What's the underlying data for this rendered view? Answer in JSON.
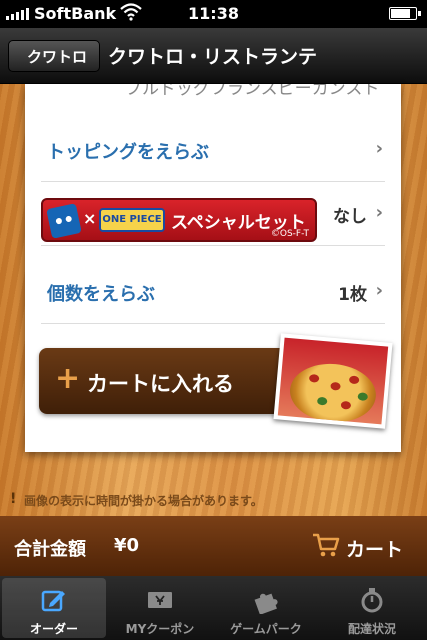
{
  "status_bar": {
    "carrier": "SoftBank",
    "time": "11:38",
    "battery_level": 0.85
  },
  "nav": {
    "back_label": "クワトロ",
    "title": "クワトロ・リストランテ"
  },
  "card": {
    "clipped_text": "ブルドッグフランスピーカンスト",
    "toppings_label": "トッピングをえらぶ",
    "banner": {
      "onepiece": "ONE PIECE",
      "text": "スペシャルセット",
      "copyright": "©OS-F-T"
    },
    "special_value": "なし",
    "quantity_label": "個数をえらぶ",
    "quantity_value": "1枚",
    "add_to_cart_label": "カートに入れる"
  },
  "notice": {
    "text": "画像の表示に時間が掛かる場合があります。"
  },
  "total_bar": {
    "label": "合計金額",
    "amount": "¥0",
    "cart_label": "カート"
  },
  "tabs": [
    {
      "label": "オーダー",
      "icon": "order-icon",
      "active": true
    },
    {
      "label": "MYクーポン",
      "icon": "coupon-icon",
      "active": false
    },
    {
      "label": "ゲームパーク",
      "icon": "puzzle-icon",
      "active": false
    },
    {
      "label": "配達状況",
      "icon": "stopwatch-icon",
      "active": false
    }
  ],
  "colors": {
    "link_blue": "#2a6fae",
    "wood": "#dd9245",
    "brown_bar": "#5a2b0c",
    "banner_red": "#c81a22"
  }
}
